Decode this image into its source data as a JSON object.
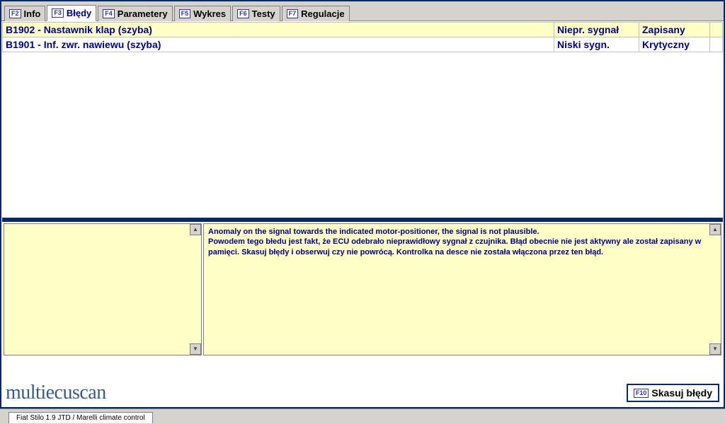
{
  "tabs": {
    "items": [
      {
        "key": "F2",
        "label": "Info"
      },
      {
        "key": "F3",
        "label": "Błędy"
      },
      {
        "key": "F4",
        "label": "Parametery"
      },
      {
        "key": "F5",
        "label": "Wykres"
      },
      {
        "key": "F6",
        "label": "Testy"
      },
      {
        "key": "F7",
        "label": "Regulacje"
      }
    ],
    "active_index": 1
  },
  "errors": {
    "rows": [
      {
        "code_desc": "B1902 - Nastawnik klap (szyba)",
        "signal": "Niepr. sygnał",
        "status": "Zapisany",
        "highlight": true
      },
      {
        "code_desc": "B1901 - Inf. zwr. nawiewu (szyba)",
        "signal": "Niski sygn.",
        "status": "Krytyczny",
        "highlight": false
      }
    ]
  },
  "detail": {
    "text": "Anomaly on the signal towards the indicated motor-positioner, the signal is not plausible.\nPowodem tego błedu jest fakt, że ECU odebrało nieprawidłowy sygnał z czujnika. Błąd obecnie nie jest aktywny ale został zapisany w pamięci. Skasuj błędy i obserwuj czy nie powrócą. Kontrolka na desce nie została włączona przez ten błąd."
  },
  "bottom": {
    "logo": "multiecuscan",
    "clear_key": "F10",
    "clear_label": "Skasuj błędy"
  },
  "status": {
    "vehicle": "Fiat Stilo 1.9 JTD / Marelli climate control"
  }
}
